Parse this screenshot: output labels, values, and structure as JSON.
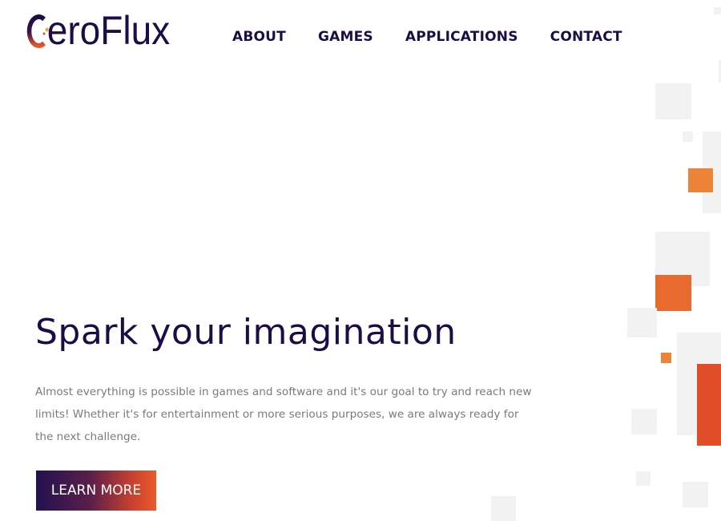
{
  "brand": {
    "name_rest": "eroFlux",
    "color": "#1b0d45",
    "accent": "#e8572b"
  },
  "nav": {
    "items": [
      {
        "label": "ABOUT"
      },
      {
        "label": "GAMES"
      },
      {
        "label": "APPLICATIONS"
      },
      {
        "label": "CONTACT"
      }
    ]
  },
  "hero": {
    "title": "Spark your imagination",
    "text": "Almost everything is possible in games and software and it's our goal to try and reach new limits! Whether it's for entertainment or more serious purposes, we are always ready for the next challenge.",
    "cta_label": "LEARN MORE"
  },
  "decor": {
    "icon": "pixel-squares-pattern",
    "colors": [
      "#f2f2f2",
      "#ed8336",
      "#e96a2e",
      "#e14d28"
    ]
  }
}
